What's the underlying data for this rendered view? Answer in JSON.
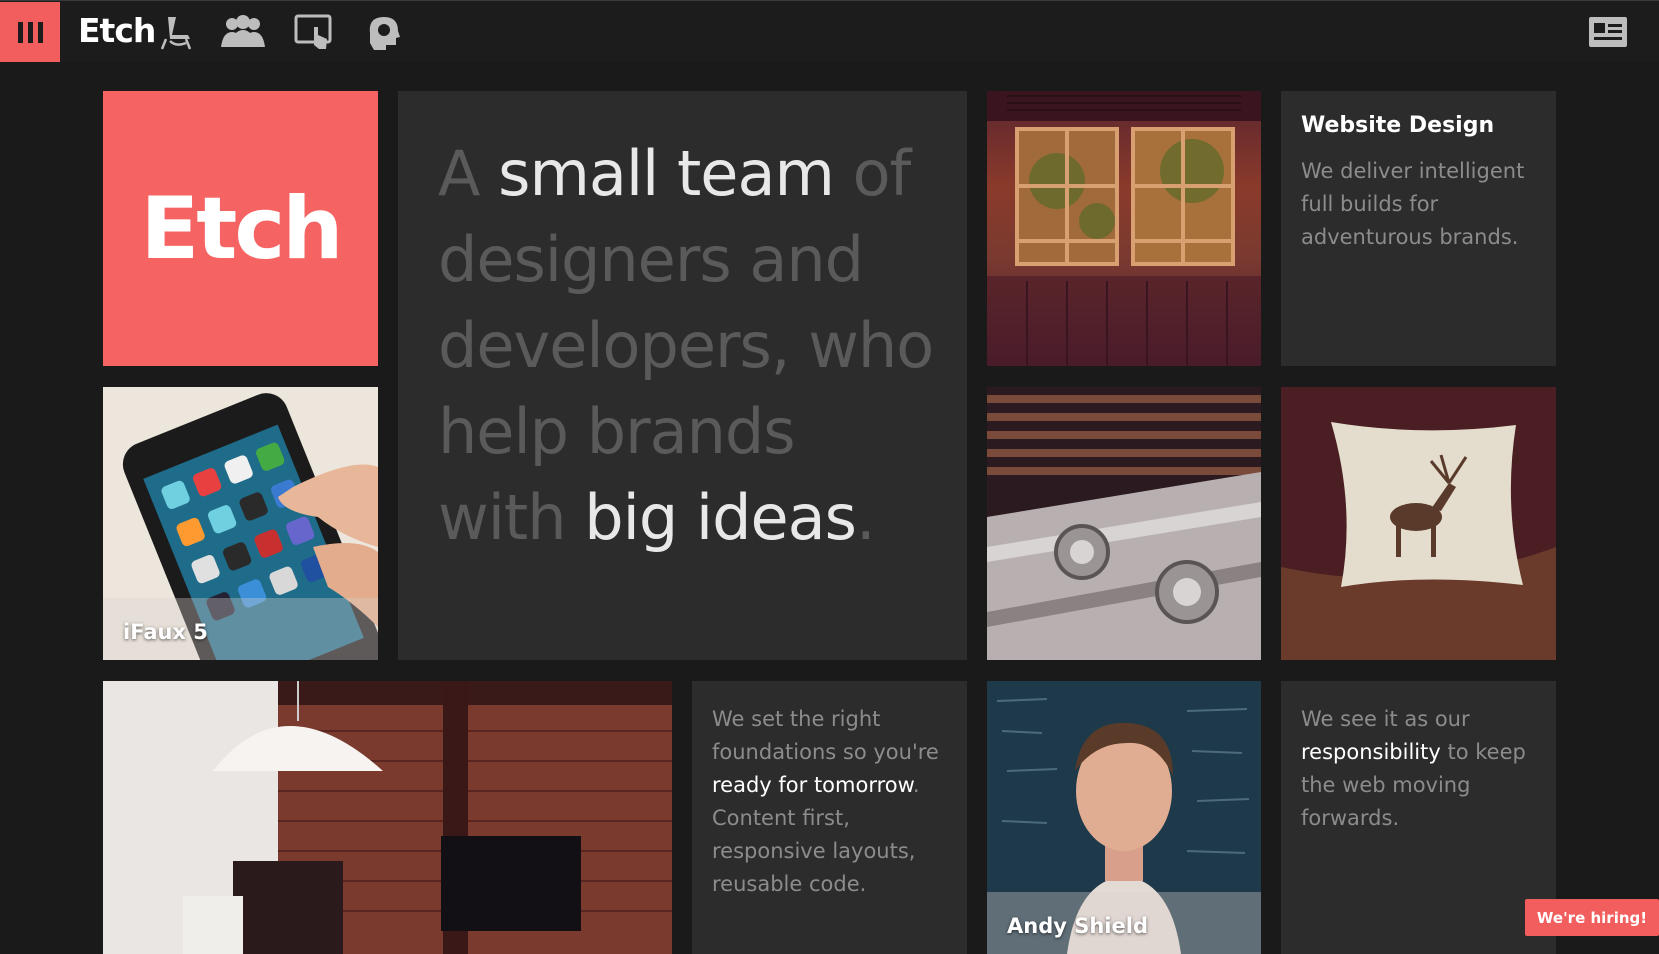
{
  "header": {
    "brand": "Etch",
    "nav_icons": [
      "chair-icon",
      "team-icon",
      "touchscreen-icon",
      "head-idea-icon"
    ],
    "right_icon": "newspaper-icon"
  },
  "logo_tile": {
    "brand": "Etch",
    "color": "#f66363"
  },
  "hero": {
    "part1": "A",
    "part2": "small team",
    "part3": "of designers and developers, who help brands with",
    "part4": "big ideas",
    "part5": "."
  },
  "service": {
    "title": "Website Design",
    "body": "We deliver intelligent full builds for adventurous brands."
  },
  "project": {
    "caption": "iFaux 5"
  },
  "foundations": {
    "part1": "We set the right foundations so you're",
    "part2": "ready for tomorrow",
    "part3": ". Content first, responsive layouts, reusable code."
  },
  "responsibility": {
    "part1": "We see it as our",
    "part2": "responsibility",
    "part3": "to keep the web moving forwards."
  },
  "person": {
    "name": "Andy Shield"
  },
  "hiring": {
    "label": "We're hiring!"
  },
  "colors": {
    "accent": "#f25d5d",
    "background": "#1a1a1a",
    "tile": "#2c2c2c"
  }
}
